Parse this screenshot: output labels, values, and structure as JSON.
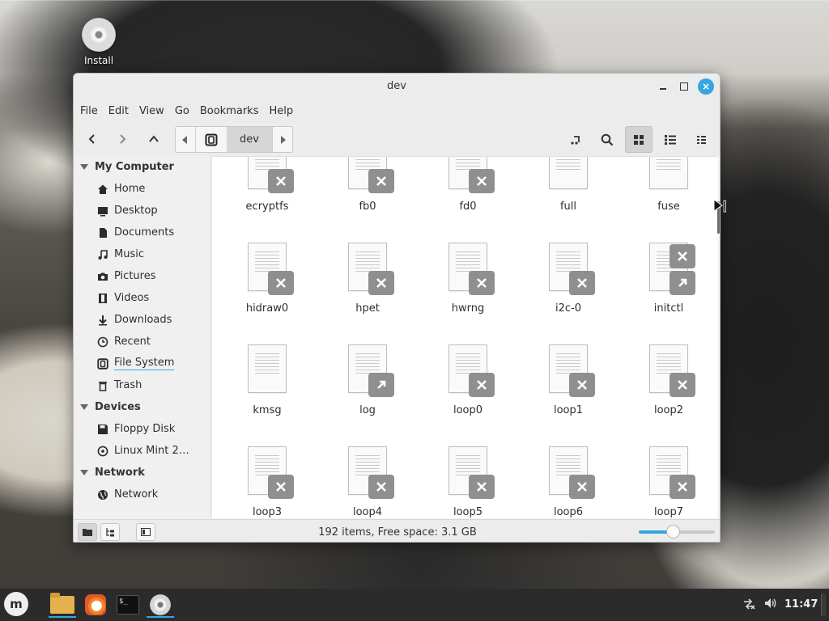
{
  "desktop": {
    "icons": [
      {
        "label": "Install",
        "icon": "disc-icon"
      }
    ]
  },
  "window": {
    "title": "dev",
    "controls": {
      "minimize": "minimize-icon",
      "maximize": "maximize-icon",
      "close": "×"
    }
  },
  "menubar": {
    "items": [
      "File",
      "Edit",
      "View",
      "Go",
      "Bookmarks",
      "Help"
    ]
  },
  "toolbar": {
    "back": "‹",
    "forward": "›",
    "up": "^",
    "path": {
      "current": "dev",
      "root_icon": "filesystem-icon"
    },
    "view_mode": "icons"
  },
  "sidebar": {
    "sections": [
      {
        "header": "My Computer",
        "items": [
          {
            "label": "Home",
            "icon": "home-icon"
          },
          {
            "label": "Desktop",
            "icon": "desktop-icon"
          },
          {
            "label": "Documents",
            "icon": "documents-icon"
          },
          {
            "label": "Music",
            "icon": "music-icon"
          },
          {
            "label": "Pictures",
            "icon": "camera-icon"
          },
          {
            "label": "Videos",
            "icon": "film-icon"
          },
          {
            "label": "Downloads",
            "icon": "download-icon"
          },
          {
            "label": "Recent",
            "icon": "clock-icon"
          },
          {
            "label": "File System",
            "icon": "filesystem-icon",
            "current": true
          },
          {
            "label": "Trash",
            "icon": "trash-icon"
          }
        ]
      },
      {
        "header": "Devices",
        "items": [
          {
            "label": "Floppy Disk",
            "icon": "floppy-icon"
          },
          {
            "label": "Linux Mint 2…",
            "icon": "disc-icon"
          }
        ]
      },
      {
        "header": "Network",
        "items": [
          {
            "label": "Network",
            "icon": "globe-icon"
          }
        ]
      }
    ]
  },
  "files": [
    {
      "name": "ecryptfs",
      "emblems": [
        "x"
      ]
    },
    {
      "name": "fb0",
      "emblems": [
        "x"
      ]
    },
    {
      "name": "fd0",
      "emblems": [
        "x"
      ]
    },
    {
      "name": "full",
      "emblems": []
    },
    {
      "name": "fuse",
      "emblems": []
    },
    {
      "name": "hidraw0",
      "emblems": [
        "x"
      ]
    },
    {
      "name": "hpet",
      "emblems": [
        "x"
      ]
    },
    {
      "name": "hwrng",
      "emblems": [
        "x"
      ]
    },
    {
      "name": "i2c-0",
      "emblems": [
        "x"
      ]
    },
    {
      "name": "initctl",
      "emblems": [
        "x",
        "link"
      ]
    },
    {
      "name": "kmsg",
      "emblems": []
    },
    {
      "name": "log",
      "emblems": [
        "link"
      ]
    },
    {
      "name": "loop0",
      "emblems": [
        "x"
      ]
    },
    {
      "name": "loop1",
      "emblems": [
        "x"
      ]
    },
    {
      "name": "loop2",
      "emblems": [
        "x"
      ]
    },
    {
      "name": "loop3",
      "emblems": [
        "x"
      ]
    },
    {
      "name": "loop4",
      "emblems": [
        "x"
      ]
    },
    {
      "name": "loop5",
      "emblems": [
        "x"
      ]
    },
    {
      "name": "loop6",
      "emblems": [
        "x"
      ]
    },
    {
      "name": "loop7",
      "emblems": [
        "x"
      ]
    }
  ],
  "statusbar": {
    "text": "192 items, Free space: 3.1 GB",
    "zoom_fraction": 0.45
  },
  "taskbar": {
    "apps": [
      "mint-menu-icon",
      "files-icon",
      "firefox-icon",
      "terminal-icon",
      "disc-icon"
    ],
    "terminal_prompt": "$_",
    "clock": "11:47"
  },
  "colors": {
    "accent": "#35a6e1",
    "emblem": "#8f8f8f"
  }
}
